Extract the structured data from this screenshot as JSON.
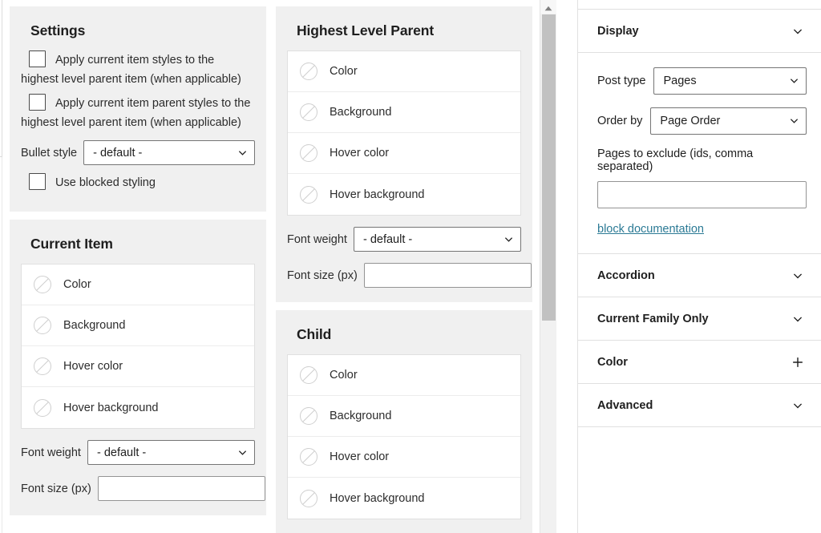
{
  "editor": {
    "panels": [
      {
        "id": "settings",
        "title": "Settings",
        "checkboxes": [
          {
            "label": "Apply current item styles to the highest level parent item (when applicable)",
            "checked": false
          },
          {
            "label": "Apply current item parent styles to the highest level parent item (when applicable)",
            "checked": false
          }
        ],
        "bullet_style": {
          "label": "Bullet style",
          "value": "- default -"
        },
        "blocked_styling": {
          "label": "Use blocked styling",
          "checked": false
        }
      },
      {
        "id": "current-item",
        "title": "Current Item",
        "swatches": [
          {
            "label": "Color",
            "value": "none"
          },
          {
            "label": "Background",
            "value": "none"
          },
          {
            "label": "Hover color",
            "value": "none"
          },
          {
            "label": "Hover background",
            "value": "none"
          }
        ],
        "font_weight": {
          "label": "Font weight",
          "value": "- default -"
        },
        "font_size": {
          "label": "Font size (px)",
          "value": "",
          "placeholder": ""
        }
      },
      {
        "id": "highest-level-parent",
        "title": "Highest Level Parent",
        "swatches": [
          {
            "label": "Color",
            "value": "none"
          },
          {
            "label": "Background",
            "value": "none"
          },
          {
            "label": "Hover color",
            "value": "none"
          },
          {
            "label": "Hover background",
            "value": "none"
          }
        ],
        "font_weight": {
          "label": "Font weight",
          "value": "- default -"
        },
        "font_size": {
          "label": "Font size (px)",
          "value": "",
          "placeholder": ""
        }
      },
      {
        "id": "child",
        "title": "Child",
        "swatches": [
          {
            "label": "Color",
            "value": "none"
          },
          {
            "label": "Background",
            "value": "none"
          },
          {
            "label": "Hover color",
            "value": "none"
          },
          {
            "label": "Hover background",
            "value": "none"
          }
        ]
      }
    ]
  },
  "scrollbar": {
    "up_arrow": "triangle-up-icon",
    "thumb_color": "#c1c1c1"
  },
  "sidebar": {
    "sections": [
      {
        "id": "display",
        "title": "Display",
        "toggle": "chevron-down-icon",
        "expanded": true
      },
      {
        "id": "accordion",
        "title": "Accordion",
        "toggle": "chevron-down-icon",
        "expanded": false
      },
      {
        "id": "current-family-only",
        "title": "Current Family Only",
        "toggle": "chevron-down-icon",
        "expanded": false
      },
      {
        "id": "color",
        "title": "Color",
        "toggle": "plus-icon",
        "expanded": false
      },
      {
        "id": "advanced",
        "title": "Advanced",
        "toggle": "chevron-down-icon",
        "expanded": false
      }
    ],
    "display": {
      "post_type": {
        "label": "Post type",
        "value": "Pages"
      },
      "order_by": {
        "label": "Order by",
        "value": "Page Order"
      },
      "exclude": {
        "label": "Pages to exclude (ids, comma separated)",
        "value": "",
        "placeholder": ""
      },
      "doc_link": "block documentation"
    }
  },
  "colors": {
    "panel_bg": "#f0f0f0",
    "page_bg": "#ffffff",
    "border": "#e0e0e0",
    "text": "#1e1e1e",
    "link": "#2b7a95",
    "scrollbar_thumb": "#c1c1c1"
  }
}
